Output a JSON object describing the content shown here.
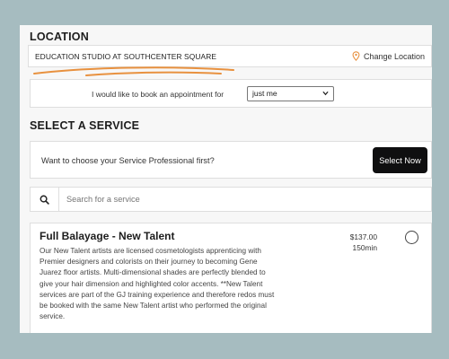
{
  "location": {
    "heading": "LOCATION",
    "name": "EDUCATION STUDIO AT SOUTHCENTER SQUARE",
    "change_label": "Change Location",
    "pin_icon": "map-pin-icon",
    "accent_color": "#e8913f"
  },
  "booking": {
    "label": "I would like to book an appointment for",
    "selected": "just me"
  },
  "service": {
    "heading": "SELECT A SERVICE",
    "prompt": "Want to choose your Service Professional first?",
    "select_now_label": "Select Now",
    "search_placeholder": "Search for a service",
    "search_icon": "search-icon"
  },
  "services": [
    {
      "name": "Full Balayage - New Talent",
      "description": "Our New Talent artists are licensed cosmetologists apprenticing with Premier designers and colorists on their journey to becoming Gene Juarez floor artists. Multi-dimensional shades are perfectly blended to give your hair dimension and highlighted color accents. **New Talent services are part of the GJ training experience and therefore redos must be booked with the same New Talent artist who performed the original service.",
      "price": "$137.00",
      "duration": "150min"
    }
  ]
}
